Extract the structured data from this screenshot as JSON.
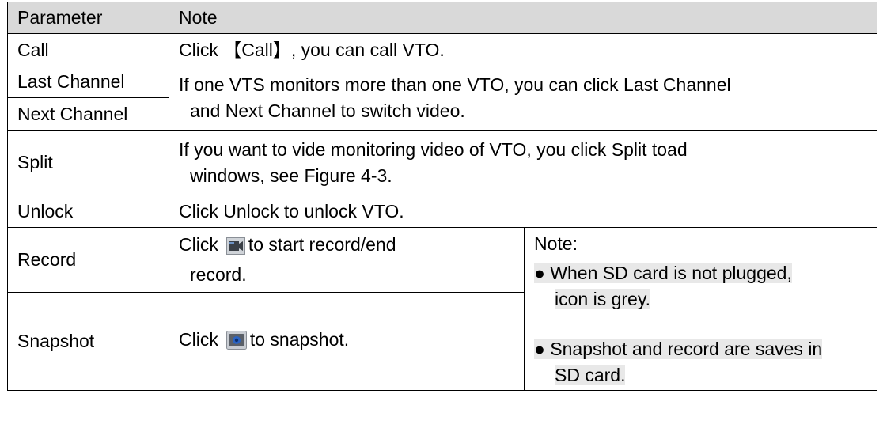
{
  "table": {
    "header": {
      "parameter": "Parameter",
      "note": "Note"
    },
    "call": {
      "param": "Call",
      "pre": "Click ",
      "bracket_open": "【",
      "key": "Call",
      "bracket_close": "】",
      "post": ", you can call VTO."
    },
    "last_channel": {
      "param": "Last Channel"
    },
    "next_channel": {
      "param": "Next Channel"
    },
    "channel_note": {
      "line1": "If one VTS monitors more than one VTO, you can click Last Channel",
      "line2": "and Next Channel to switch video."
    },
    "split": {
      "param": "Split",
      "line1": "If you want to vide monitoring video of VTO, you click Split toad",
      "line2": "windows, see Figure 4-3."
    },
    "unlock": {
      "param": "Unlock",
      "note": "Click Unlock to unlock VTO."
    },
    "record": {
      "param": "Record",
      "pre": "Click",
      "post": "to start record/end",
      "line2": "record.",
      "icon": "record-icon"
    },
    "snapshot": {
      "param": "Snapshot",
      "pre": "Click",
      "post": "to snapshot.",
      "icon": "camera-icon"
    },
    "side_note": {
      "title": "Note:",
      "b1_line1": "● When SD card is not plugged,",
      "b1_line2": "icon is grey.",
      "b2_line1": "● Snapshot and record are saves in",
      "b2_line2": "SD card."
    }
  }
}
